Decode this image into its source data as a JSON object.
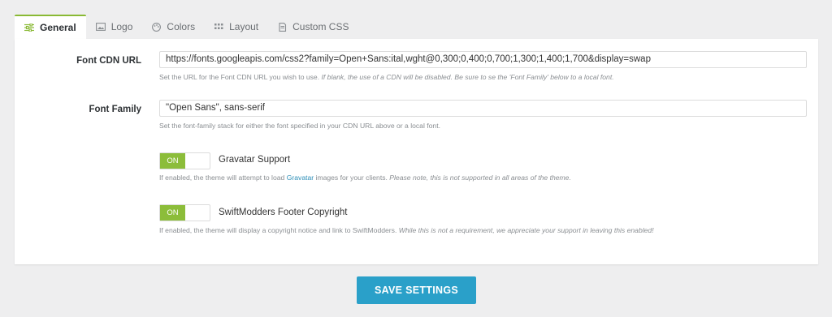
{
  "tabs": [
    {
      "label": "General",
      "icon": "sliders-icon",
      "active": true
    },
    {
      "label": "Logo",
      "icon": "image-icon"
    },
    {
      "label": "Colors",
      "icon": "palette-icon"
    },
    {
      "label": "Layout",
      "icon": "grid-icon"
    },
    {
      "label": "Custom CSS",
      "icon": "code-file-icon"
    }
  ],
  "font_cdn": {
    "label": "Font CDN URL",
    "value": "https://fonts.googleapis.com/css2?family=Open+Sans:ital,wght@0,300;0,400;0,700;1,300;1,400;1,700&display=swap",
    "help": "Set the URL for the Font CDN URL you wish to use.",
    "help_italic": "If blank, the use of a CDN will be disabled. Be sure to se the 'Font Family' below to a local font."
  },
  "font_family": {
    "label": "Font Family",
    "value": "\"Open Sans\", sans-serif",
    "help": "Set the font-family stack for either the font specified in your CDN URL above or a local font."
  },
  "gravatar": {
    "toggle": "ON",
    "label": "Gravatar Support",
    "help_pre": "If enabled, the theme will attempt to load",
    "help_link": "Gravatar",
    "help_post": "images for your clients.",
    "help_italic": "Please note, this is not supported in all areas of the theme."
  },
  "footer_copyright": {
    "toggle": "ON",
    "label": "SwiftModders Footer Copyright",
    "help": "If enabled, the theme will display a copyright notice and link to SwiftModders.",
    "help_italic": "While this is not a requirement, we appreciate your support in leaving this enabled!"
  },
  "save_label": "SAVE SETTINGS",
  "colors": {
    "accent_green": "#8cbd3a",
    "button_blue": "#2aa0c9",
    "link_blue": "#2e8fb8"
  }
}
